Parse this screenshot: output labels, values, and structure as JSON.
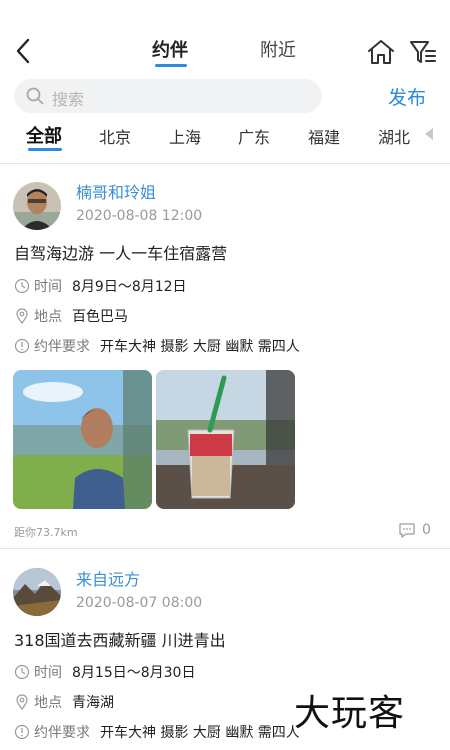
{
  "header": {
    "tabs": [
      {
        "label": "约伴",
        "active": true
      },
      {
        "label": "附近",
        "active": false
      }
    ]
  },
  "search": {
    "placeholder": "搜索"
  },
  "publish_label": "发布",
  "regions": [
    "全部",
    "北京",
    "上海",
    "广东",
    "福建",
    "湖北"
  ],
  "active_region": "全部",
  "accent_color": "#2a8be0",
  "posts": [
    {
      "username": "楠哥和玲姐",
      "date": "2020-08-08 12:00",
      "title": "自驾海边游 一人一车住宿露营",
      "time_label": "时间",
      "time_value": "8月9日～8月12日",
      "place_label": "地点",
      "place_value": "百色巴马",
      "req_label": "约伴要求",
      "req_value": "开车大神 摄影 大厨 幽默 需四人",
      "distance": "距你73.7km",
      "comment_count": "0",
      "photos": [
        "selfie-photo",
        "drink-photo"
      ]
    },
    {
      "username": "来自远方",
      "date": "2020-08-07 08:00",
      "title": "318国道去西藏新疆 川进青出",
      "time_label": "时间",
      "time_value": "8月15日～8月30日",
      "place_label": "地点",
      "place_value": "青海湖",
      "req_label": "约伴要求",
      "req_value": "开车大神 摄影 大厨 幽默 需四人"
    }
  ],
  "watermark": "大玩客"
}
